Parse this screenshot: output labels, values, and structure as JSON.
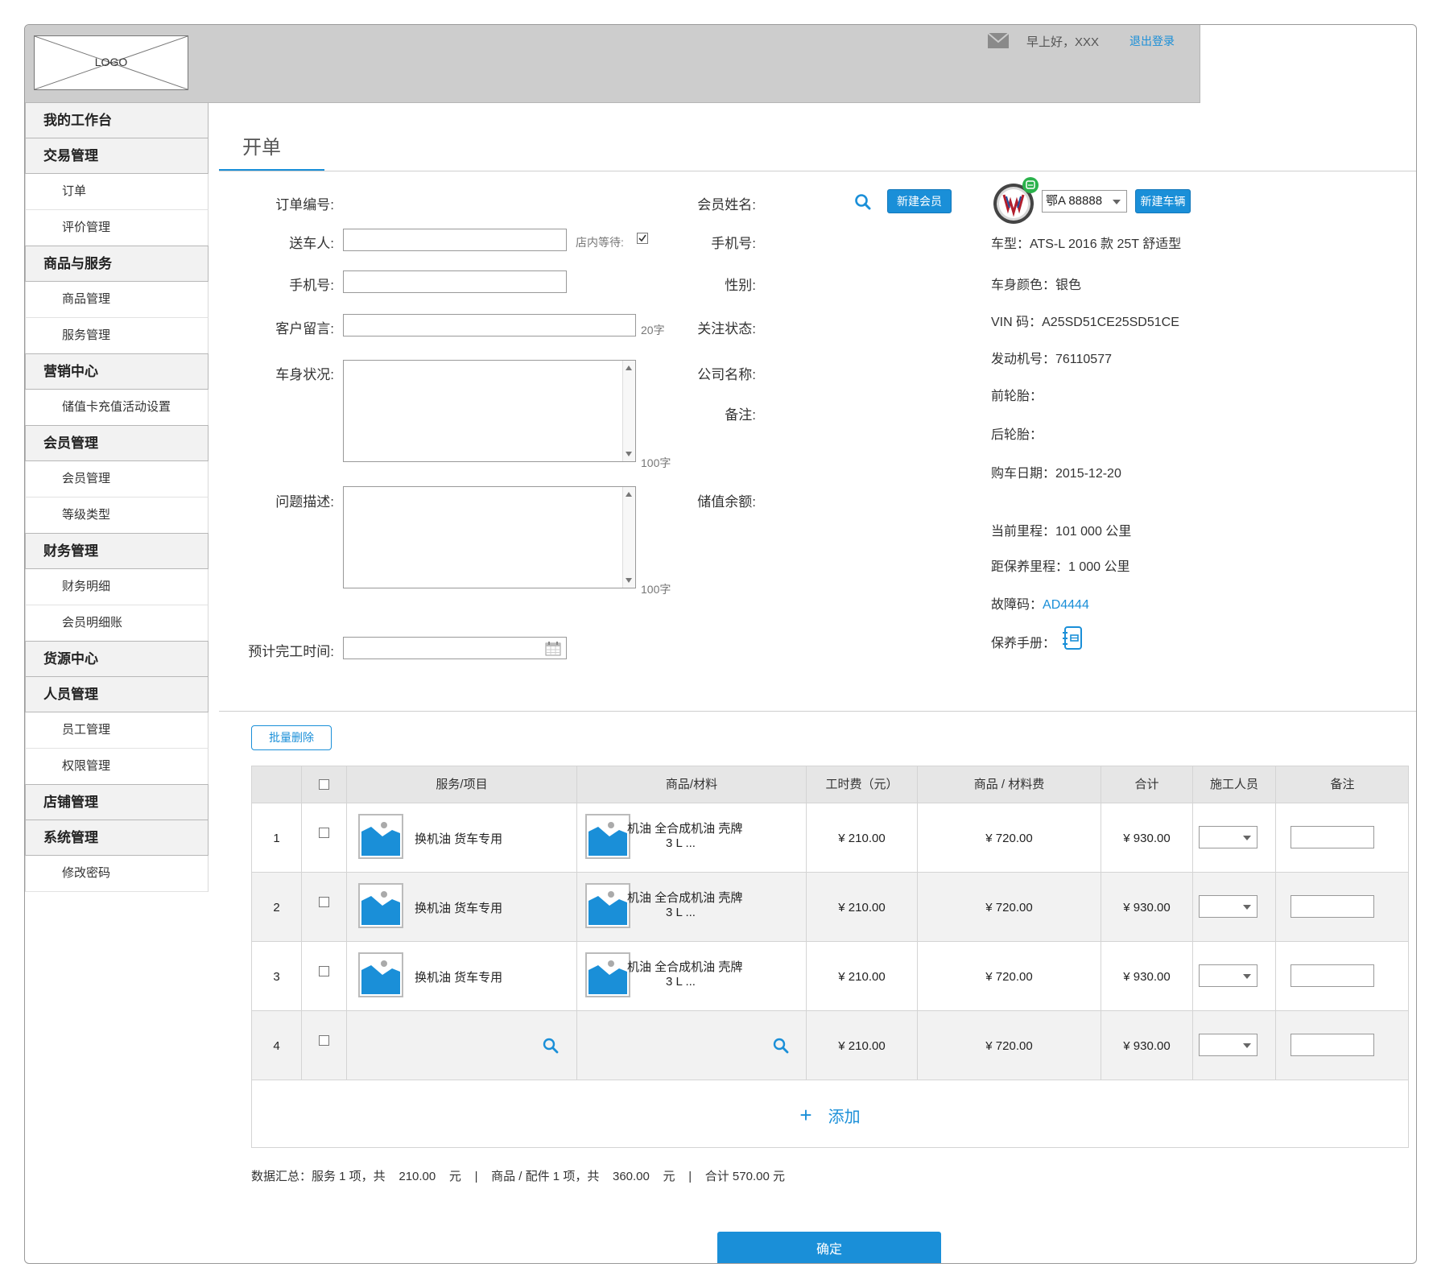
{
  "header": {
    "logo_text": "LOGO",
    "greeting": "早上好，XXX",
    "logout": "退出登录"
  },
  "sidebar": {
    "items": [
      {
        "type": "group",
        "label": "我的工作台"
      },
      {
        "type": "group",
        "label": "交易管理"
      },
      {
        "type": "item",
        "label": "订单"
      },
      {
        "type": "item",
        "label": "评价管理"
      },
      {
        "type": "group",
        "label": "商品与服务"
      },
      {
        "type": "item",
        "label": "商品管理"
      },
      {
        "type": "item",
        "label": "服务管理"
      },
      {
        "type": "group",
        "label": "营销中心"
      },
      {
        "type": "item",
        "label": "储值卡充值活动设置"
      },
      {
        "type": "group",
        "label": "会员管理"
      },
      {
        "type": "item",
        "label": "会员管理"
      },
      {
        "type": "item",
        "label": "等级类型"
      },
      {
        "type": "group",
        "label": "财务管理"
      },
      {
        "type": "item",
        "label": "财务明细"
      },
      {
        "type": "item",
        "label": "会员明细账"
      },
      {
        "type": "group",
        "label": "货源中心"
      },
      {
        "type": "group",
        "label": "人员管理"
      },
      {
        "type": "item",
        "label": "员工管理"
      },
      {
        "type": "item",
        "label": "权限管理"
      },
      {
        "type": "group",
        "label": "店铺管理"
      },
      {
        "type": "group",
        "label": "系统管理"
      },
      {
        "type": "item",
        "label": "修改密码"
      }
    ]
  },
  "page": {
    "title": "开单"
  },
  "form": {
    "order_no_label": "订单编号:",
    "sender_label": "送车人:",
    "wait_label": "店内等待:",
    "phone_label": "手机号:",
    "message_label": "客户留言:",
    "message_hint": "20字",
    "body_label": "车身状况:",
    "body_hint": "100字",
    "problem_label": "问题描述:",
    "problem_hint": "100字",
    "eta_label": "预计完工时间:"
  },
  "member": {
    "name_label": "会员姓名:",
    "new_member": "新建会员",
    "phone_label": "手机号:",
    "gender_label": "性别:",
    "follow_label": "关注状态:",
    "company_label": "公司名称:",
    "remark_label": "备注:",
    "balance_label": "储值余额:"
  },
  "vehicle": {
    "plate": "鄂A 88888",
    "new_vehicle": "新建车辆",
    "model": "车型：ATS-L    2016 款    25T    舒适型",
    "color": "车身颜色：银色",
    "vin": "VIN 码：A25SD51CE25SD51CE",
    "engine": "发动机号：76110577",
    "front_tire": "前轮胎：",
    "rear_tire": "后轮胎：",
    "purchase_date": "购车日期：2015-12-20",
    "mileage": "当前里程：101    000 公里",
    "service_mileage": "距保养里程：1    000 公里",
    "fault_label": "故障码：",
    "fault_code": "AD4444",
    "manual_label": "保养手册："
  },
  "table": {
    "batch_delete": "批量删除",
    "headers": [
      "服务/项目",
      "商品/材料",
      "工时费（元）",
      "商品 / 材料费",
      "合计",
      "施工人员",
      "备注"
    ],
    "rows": [
      {
        "no": "1",
        "service": "换机油   货车专用",
        "product_line1": "机油    全合成机油  壳牌",
        "product_line2": "3    L    ...",
        "labor": "¥ 210.00",
        "material": "¥ 720.00",
        "total": "¥  930.00"
      },
      {
        "no": "2",
        "service": "换机油   货车专用",
        "product_line1": "机油    全合成机油  壳牌",
        "product_line2": "3    L    ...",
        "labor": "¥ 210.00",
        "material": "¥ 720.00",
        "total": "¥  930.00"
      },
      {
        "no": "3",
        "service": "换机油   货车专用",
        "product_line1": "机油    全合成机油  壳牌",
        "product_line2": "3    L    ...",
        "labor": "¥ 210.00",
        "material": "¥ 720.00",
        "total": "¥  930.00"
      },
      {
        "no": "4",
        "service": "",
        "product_line1": "",
        "product_line2": "",
        "labor": "¥ 210.00",
        "material": "¥ 720.00",
        "total": "¥  930.00"
      }
    ],
    "add": "添加"
  },
  "summary": "数据汇总：服务 1 项，共    210.00    元    |    商品 / 配件 1 项，共    360.00    元    |    合计 570.00 元",
  "confirm": "确定",
  "colors": {
    "accent": "#1a8fd8",
    "header_bg": "#cdcdcd",
    "badge": "#2bb24c"
  }
}
